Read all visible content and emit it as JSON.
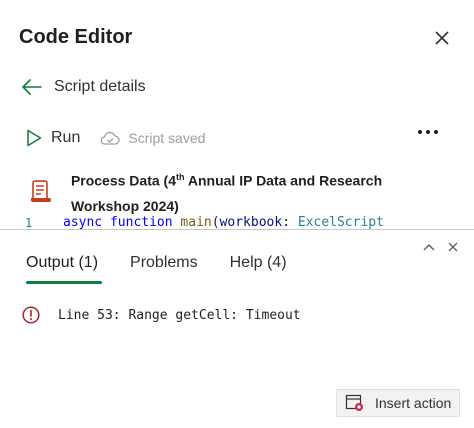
{
  "header": {
    "title": "Code Editor"
  },
  "nav": {
    "back_label": "Script details"
  },
  "toolbar": {
    "run_label": "Run",
    "saved_label": "Script saved"
  },
  "script": {
    "title_pre": "Process Data (4",
    "title_sup": "th",
    "title_post": " Annual IP Data and Research Workshop 2024)"
  },
  "editor": {
    "line_number": "1",
    "tokens": {
      "kw1": "async",
      "kw2": "function",
      "fn": "main",
      "param": "workbook",
      "colon": ": ",
      "type": "ExcelScript"
    }
  },
  "output_panel": {
    "tabs": [
      {
        "label": "Output (1)"
      },
      {
        "label": "Problems"
      },
      {
        "label": "Help (4)"
      }
    ],
    "messages": [
      {
        "text": "Line 53: Range getCell: Timeout"
      }
    ],
    "insert_action_label": "Insert action"
  },
  "colors": {
    "accent": "#107c41",
    "error": "#a4262c",
    "script_icon": "#c43e1c"
  }
}
